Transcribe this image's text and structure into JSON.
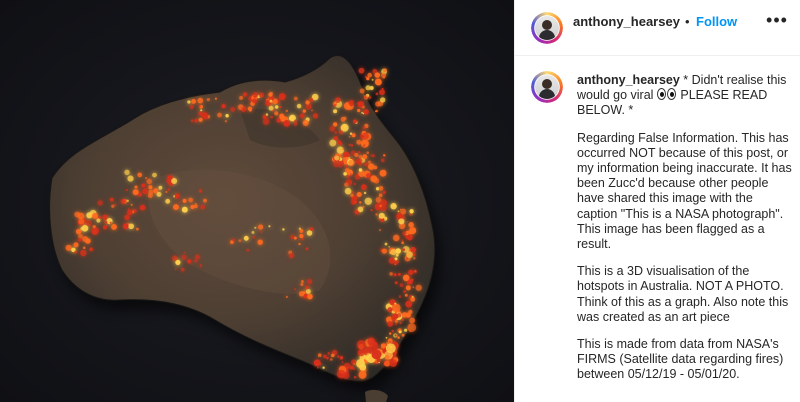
{
  "post": {
    "image_alt": "3D visualisation of bushfire hotspots across Australia",
    "username": "anthony_hearsey",
    "separator": "•",
    "follow_label": "Follow",
    "more_icon": "more-options-icon"
  },
  "comment": {
    "username": "anthony_hearsey",
    "line1_text": " * Didn't realise this would go viral ",
    "emoji_icon": "eyes-emoji-icon",
    "line1_tail": " PLEASE READ BELOW. *",
    "para2": "Regarding False Information. This has occurred NOT because of this post, or my information being inaccurate. It has been Zucc'd because other people have shared this image with the caption \"This is a NASA photograph\". This image has been flagged as a result.",
    "para3": "This is a 3D visualisation of the hotspots in Australia. NOT A PHOTO. Think of this as a graph. Also note this was created as an art piece",
    "para4": "This is made from data from NASA's FIRMS (Satellite data regarding fires) between 05/12/19 - 05/01/20."
  },
  "colors": {
    "follow_blue": "#0095f6",
    "text": "#262626",
    "divider": "#efefef",
    "image_bg": "#14151a",
    "land": "#4e3f33",
    "fire": "#ff5a1a"
  }
}
